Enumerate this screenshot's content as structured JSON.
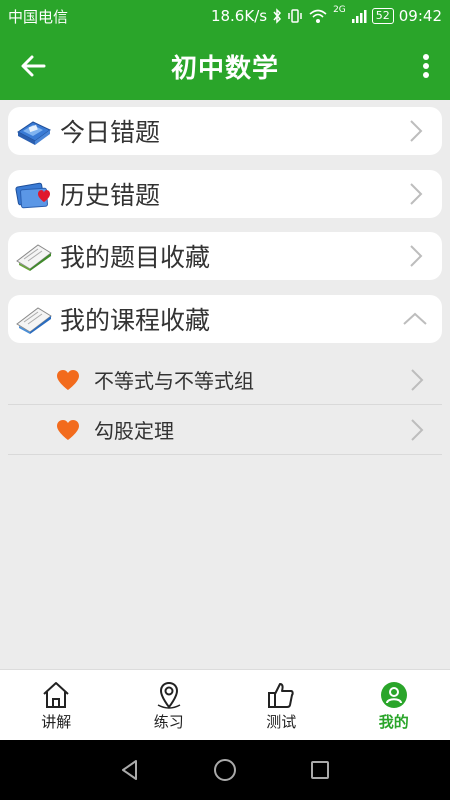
{
  "status_bar": {
    "carrier": "中国电信",
    "speed": "18.6K/s",
    "network_badge": "2G",
    "battery": "52",
    "time": "09:42"
  },
  "app_bar": {
    "title": "初中数学",
    "back_icon": "arrow-left-icon",
    "menu_icon": "more-vert-icon"
  },
  "sections": [
    {
      "label": "今日错题",
      "icon": "puzzle-icon",
      "expanded": false
    },
    {
      "label": "历史错题",
      "icon": "cards-heart-icon",
      "expanded": false
    },
    {
      "label": "我的题目收藏",
      "icon": "book-icon",
      "expanded": false
    },
    {
      "label": "我的课程收藏",
      "icon": "book-icon",
      "expanded": true
    }
  ],
  "course_favorites": [
    {
      "label": "不等式与不等式组",
      "icon": "heart-icon"
    },
    {
      "label": "勾股定理",
      "icon": "heart-icon"
    }
  ],
  "bottom_nav": [
    {
      "label": "讲解",
      "icon": "home-icon",
      "active": false
    },
    {
      "label": "练习",
      "icon": "location-pin-icon",
      "active": false
    },
    {
      "label": "测试",
      "icon": "thumbs-up-icon",
      "active": false
    },
    {
      "label": "我的",
      "icon": "user-icon",
      "active": true
    }
  ],
  "colors": {
    "primary": "#2aa52a",
    "background": "#ececec",
    "heart": "#f26b1d"
  }
}
